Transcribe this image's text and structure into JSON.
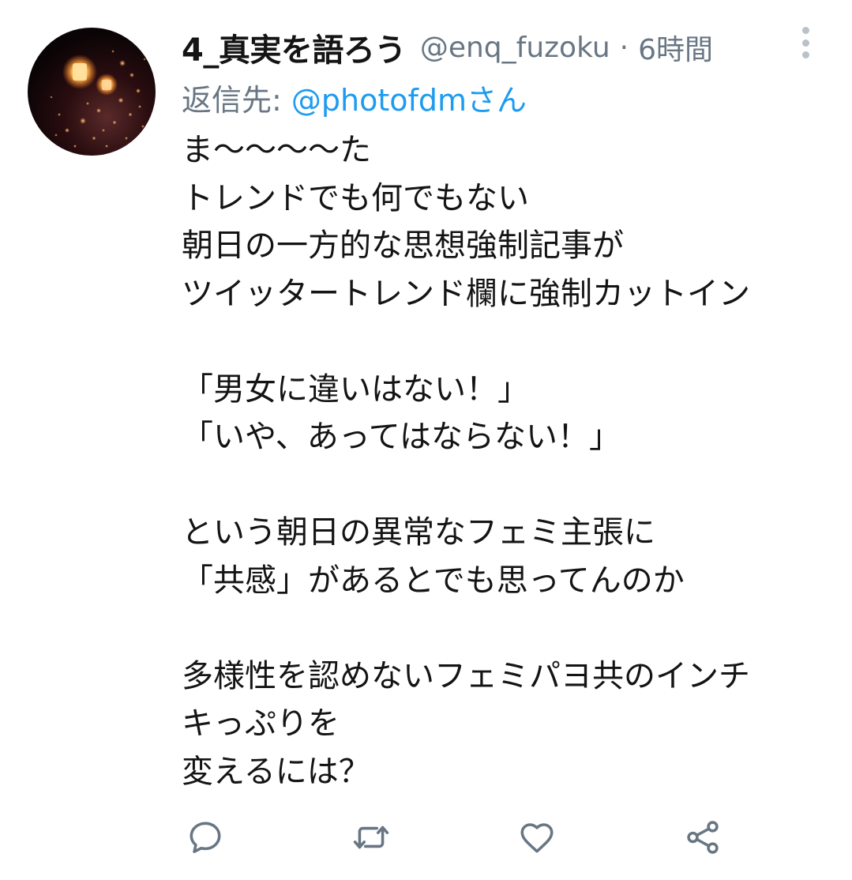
{
  "user": {
    "display_name": "4_真実を語ろう",
    "handle": "@enq_fuzoku",
    "separator": "·",
    "time": "6時間"
  },
  "reply": {
    "prefix": "返信先: ",
    "mention": "@photofdmさん"
  },
  "tweet_lines": [
    "ま〜〜〜〜た",
    "トレンドでも何でもない",
    "朝日の一方的な思想強制記事が",
    "ツイッタートレンド欄に強制カットイン",
    "",
    "「男女に違いはない！」",
    "「いや、あってはならない！」",
    "",
    "という朝日の異常なフェミ主張に",
    "「共感」があるとでも思ってんのか",
    "",
    "多様性を認めないフェミパヨ共のインチ",
    "キっぷりを",
    "変えるには？"
  ],
  "icons": {
    "more": "more-vertical-icon",
    "reply": "reply-icon",
    "retweet": "retweet-icon",
    "like": "like-icon",
    "share": "share-icon"
  },
  "colors": {
    "text": "#141414",
    "secondary": "#687684",
    "accent": "#1d9bf0",
    "icon": "#687684"
  }
}
